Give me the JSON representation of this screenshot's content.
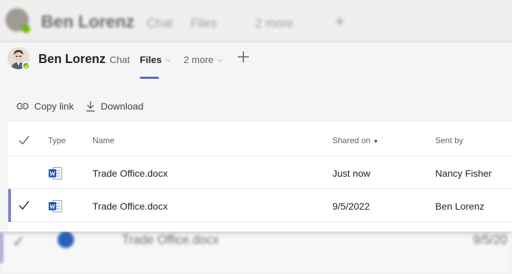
{
  "header": {
    "user_name": "Ben Lorenz",
    "tabs": [
      {
        "label": "Chat"
      },
      {
        "label": "Files",
        "chevron": "⌵",
        "active": true
      },
      {
        "label": "2 more",
        "chevron": "⌵"
      }
    ],
    "add_tab_icon": "plus-icon"
  },
  "toolbar": {
    "copy_link_label": "Copy link",
    "download_label": "Download"
  },
  "table": {
    "columns": {
      "type": "Type",
      "name": "Name",
      "shared_on": "Shared on",
      "sent_by": "Sent by"
    },
    "sort_indicator": "▼",
    "rows": [
      {
        "name": "Trade Office.docx",
        "shared_on": "Just now",
        "sent_by": "Nancy Fisher",
        "selected": false
      },
      {
        "name": "Trade Office.docx",
        "shared_on": "9/5/2022",
        "sent_by": "Ben Lorenz",
        "selected": true
      }
    ]
  },
  "background": {
    "user_name": "Ben Lorenz",
    "tabs": [
      "Chat",
      "Files",
      "2 more"
    ],
    "file_name": "Trade Office.docx",
    "date": "9/5/20"
  },
  "colors": {
    "accent": "#5b5fc7",
    "presence": "#6bb700",
    "word_blue": "#185abd"
  }
}
